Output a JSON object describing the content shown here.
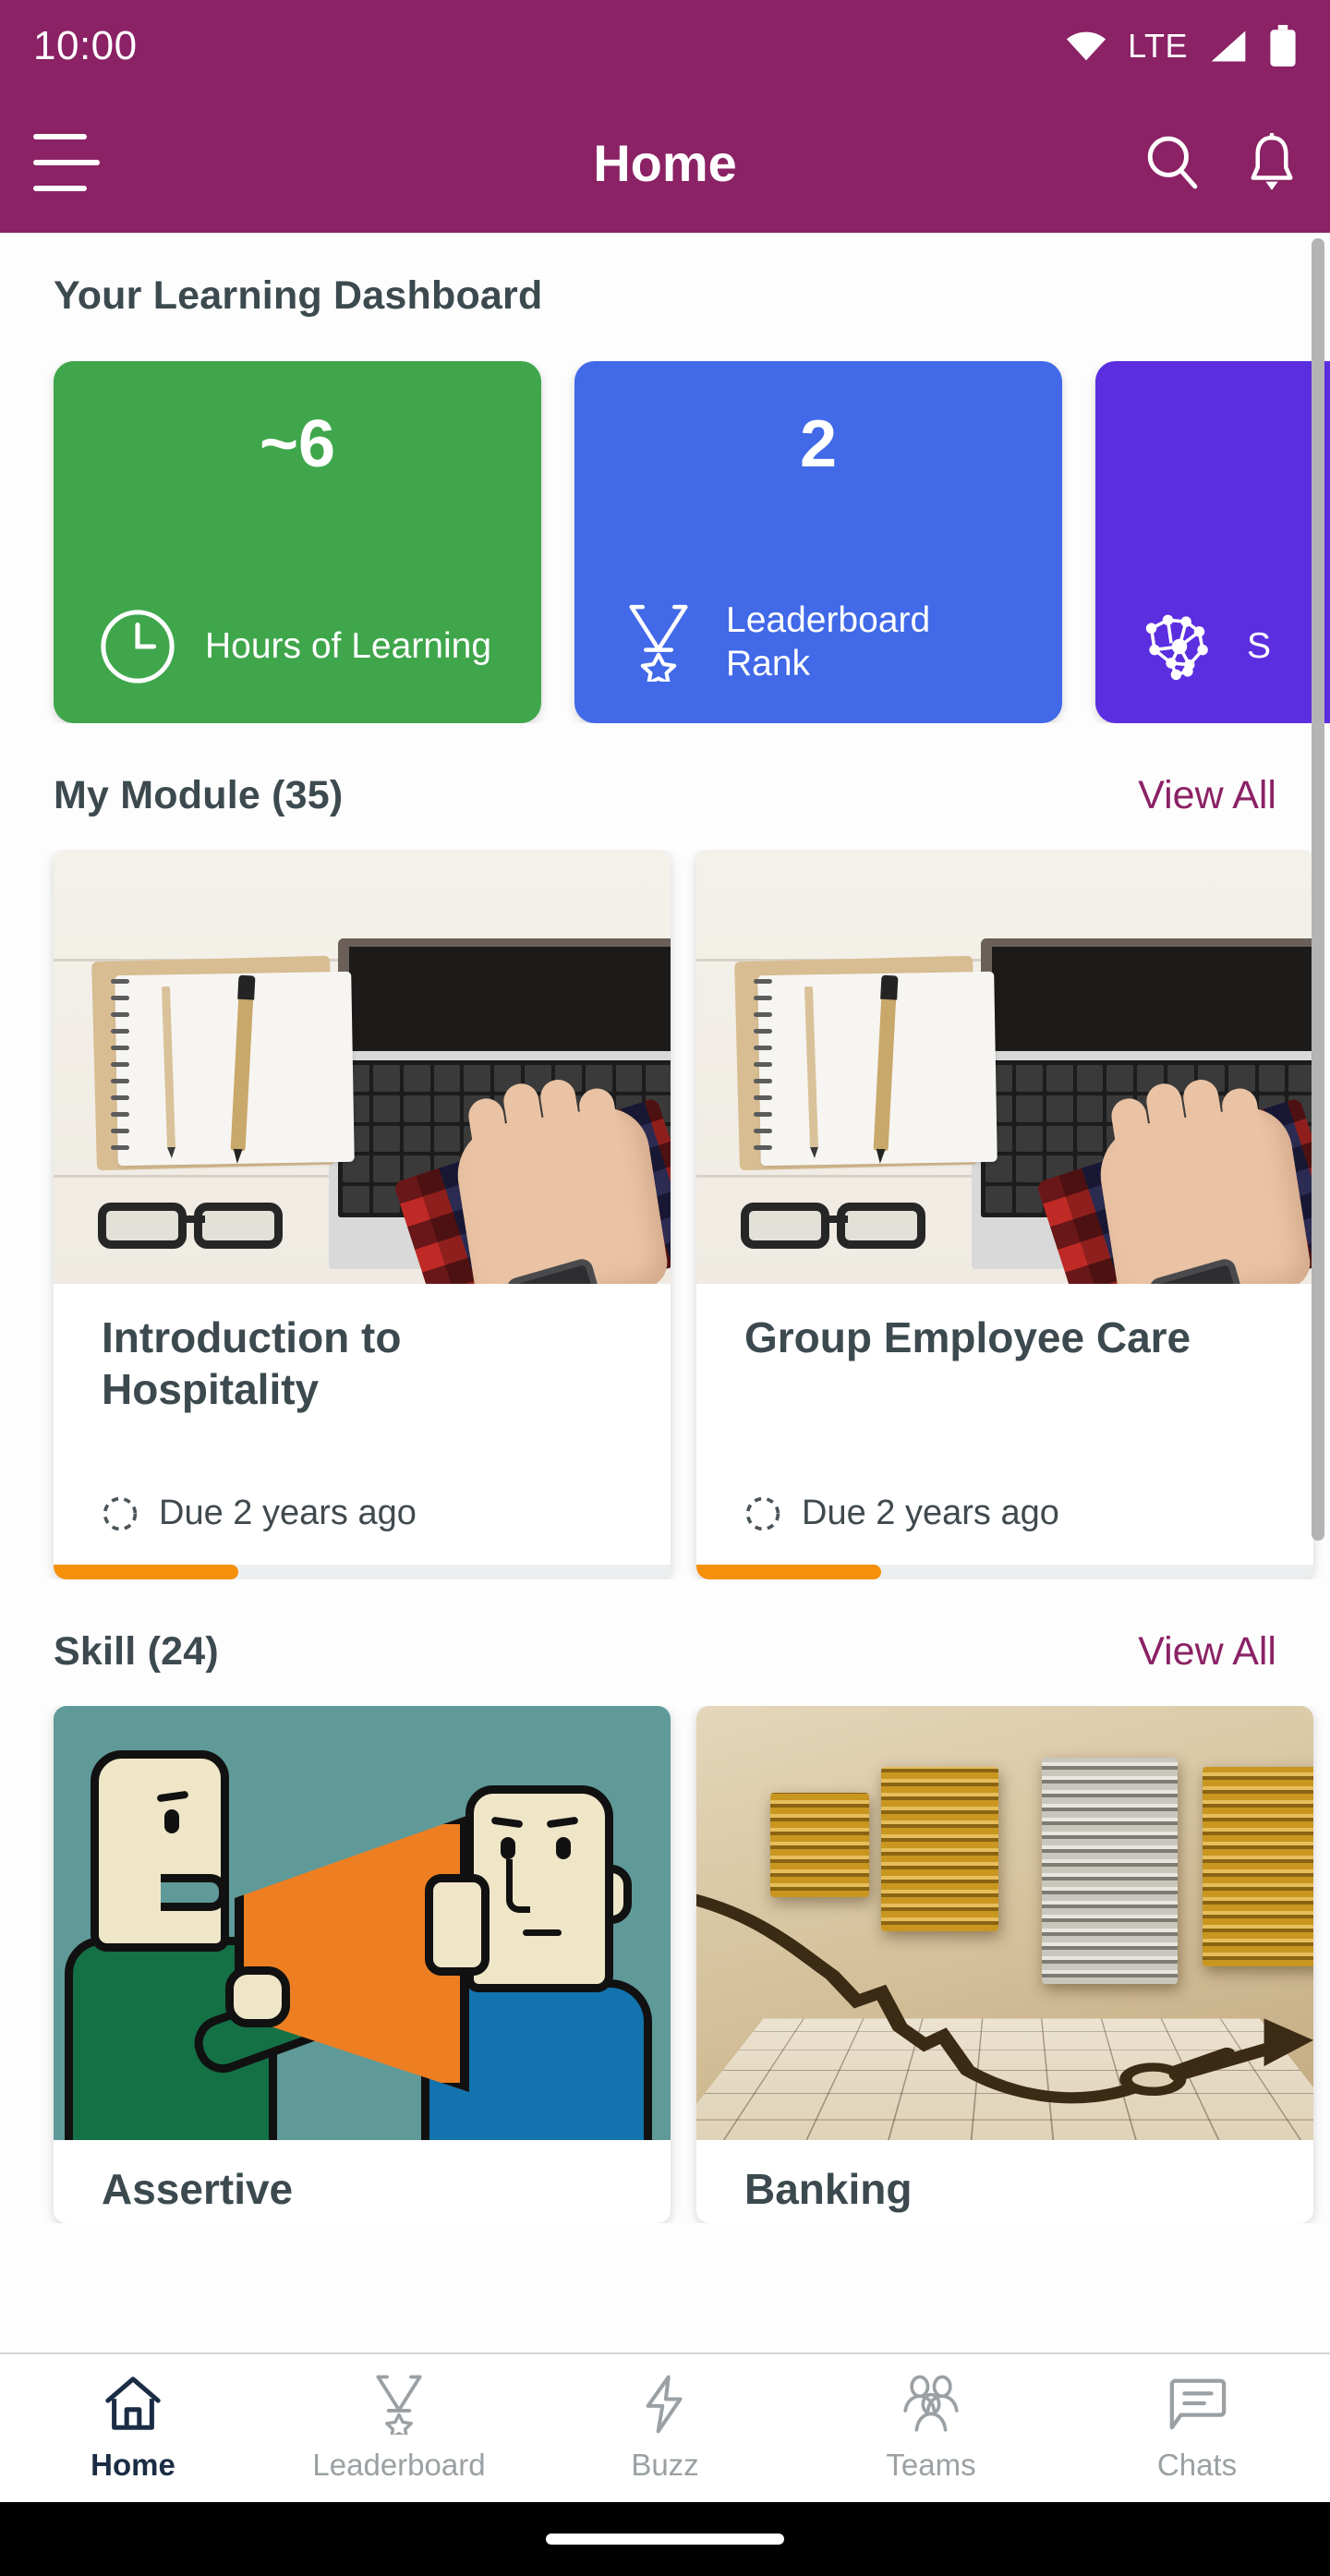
{
  "status_bar": {
    "time": "10:00",
    "network_label": "LTE",
    "icons": [
      "wifi-icon",
      "signal-icon",
      "battery-icon"
    ]
  },
  "app_bar": {
    "menu_icon": "hamburger-menu-icon",
    "title": "Home",
    "search_icon": "search-icon",
    "notifications_icon": "bell-icon",
    "background_color": "#8B2265"
  },
  "dashboard": {
    "title": "Your Learning Dashboard",
    "stats": [
      {
        "value": "~6",
        "label": "Hours of Learning",
        "icon": "clock-icon",
        "color": "#3FA64B"
      },
      {
        "value": "2",
        "label": "Leaderboard Rank",
        "icon": "medal-icon",
        "color": "#4169E8"
      },
      {
        "value": "",
        "label": "S",
        "icon": "brain-network-icon",
        "color": "#5B2EE0"
      }
    ]
  },
  "modules_section": {
    "title": "My Module (35)",
    "view_all_label": "View All",
    "view_all_color": "#8B2265",
    "cards": [
      {
        "title": "Introduction to Hospitality",
        "due_label": "Due 2 years ago",
        "due_icon": "dashed-circle-icon",
        "progress_percent": 30,
        "progress_color": "#F5900B",
        "thumbnail": "desk-laptop-photo"
      },
      {
        "title": "Group Employee Care",
        "due_label": "Due 2 years ago",
        "due_icon": "dashed-circle-icon",
        "progress_percent": 30,
        "progress_color": "#F5900B",
        "thumbnail": "desk-laptop-photo"
      }
    ]
  },
  "skills_section": {
    "title": "Skill (24)",
    "view_all_label": "View All",
    "view_all_color": "#8B2265",
    "cards": [
      {
        "title": "Assertive",
        "thumbnail": "megaphone-listening-cartoon"
      },
      {
        "title": "Banking",
        "thumbnail": "coin-stacks-chart-photo"
      }
    ]
  },
  "bottom_nav": {
    "active_index": 0,
    "active_color": "#1b2d45",
    "inactive_color": "#9aa0a3",
    "items": [
      {
        "label": "Home",
        "icon": "home-icon"
      },
      {
        "label": "Leaderboard",
        "icon": "medal-icon"
      },
      {
        "label": "Buzz",
        "icon": "lightning-bolt-icon"
      },
      {
        "label": "Teams",
        "icon": "people-group-icon"
      },
      {
        "label": "Chats",
        "icon": "chat-bubble-icon"
      }
    ]
  }
}
